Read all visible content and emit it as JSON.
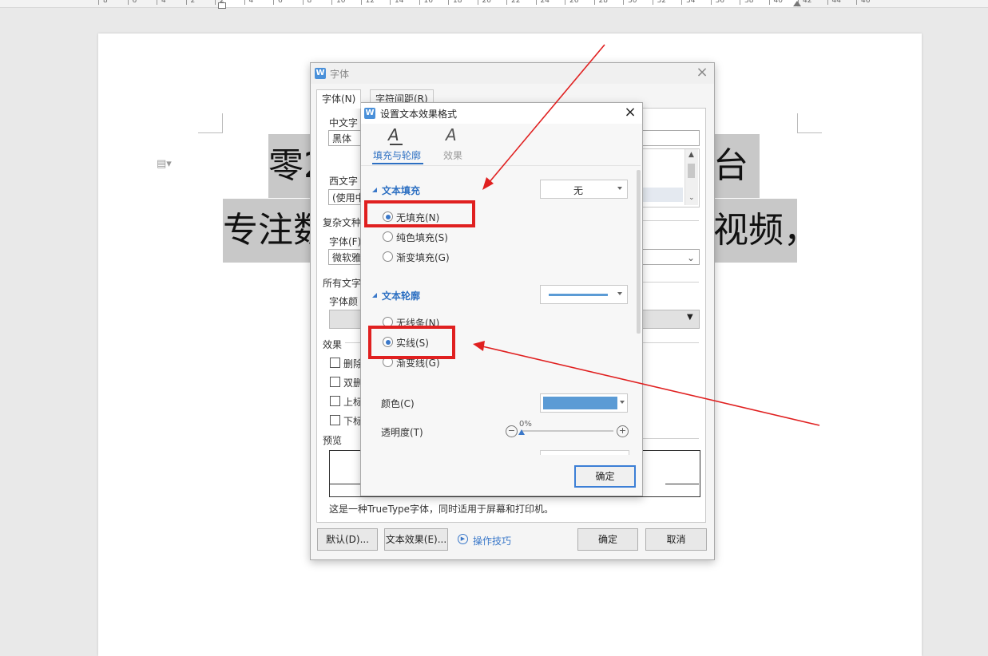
{
  "ruler": {
    "numbers": [
      "8",
      "6",
      "4",
      "2",
      "2",
      "4",
      "6",
      "8",
      "10",
      "12",
      "14",
      "16",
      "18",
      "20",
      "22",
      "24",
      "26",
      "28",
      "30",
      "32",
      "34",
      "36",
      "38",
      "40",
      "42",
      "44",
      "46"
    ]
  },
  "document": {
    "line1_left": "零2",
    "line1_right": "台",
    "line2_left": "专注数",
    "line2_right": "视频，"
  },
  "font_dialog": {
    "title": "字体",
    "tabs": [
      {
        "label": "字体(N)"
      },
      {
        "label": "字符间距(R)"
      }
    ],
    "chinese_font_label": "中文字",
    "chinese_font_value": "黑体",
    "western_font_label": "西文字",
    "western_font_value": "(使用中",
    "complex_label": "复杂文种",
    "complex_font_label": "字体(F)",
    "complex_font_value": "微软雅",
    "all_text_label": "所有文字",
    "font_color_label": "字体颜",
    "effects_label": "效果",
    "effects": [
      {
        "label": "删除"
      },
      {
        "label": "双删"
      },
      {
        "label": "上标"
      },
      {
        "label": "下标"
      }
    ],
    "preview_label": "预览",
    "description": "这是一种TrueType字体，同时适用于屏幕和打印机。",
    "default_button": "默认(D)...",
    "text_effect_button": "文本效果(E)...",
    "tips_link": "操作技巧",
    "ok_button": "确定",
    "cancel_button": "取消"
  },
  "effect_dialog": {
    "title": "设置文本效果格式",
    "tabs": [
      {
        "label": "填充与轮廓"
      },
      {
        "label": "效果"
      }
    ],
    "text_fill_header": "文本填充",
    "fill_dropdown_value": "无",
    "fill_options": [
      {
        "label": "无填充(N)"
      },
      {
        "label": "纯色填充(S)"
      },
      {
        "label": "渐变填充(G)"
      }
    ],
    "fill_selected_index": 0,
    "text_outline_header": "文本轮廓",
    "outline_options": [
      {
        "label": "无线条(N)"
      },
      {
        "label": "实线(S)"
      },
      {
        "label": "渐变线(G)"
      }
    ],
    "outline_selected_index": 1,
    "color_label": "颜色(C)",
    "transparency_label": "透明度(T)",
    "transparency_value": "0%",
    "ok_button": "确定"
  },
  "colors": {
    "accent": "#2c6fc2",
    "outline_color": "#5b9bd5",
    "annotation_red": "#e02020",
    "highlight": "#c8c8c8"
  }
}
